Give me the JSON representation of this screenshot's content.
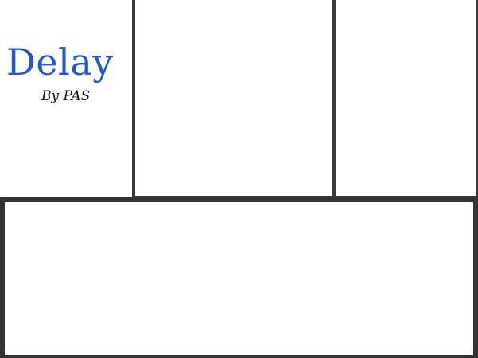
{
  "app": {
    "title": "Delay",
    "subtitle": "By PAS",
    "accent_color": "#1f57d6",
    "panel_border_color": "#3a3a3a"
  }
}
